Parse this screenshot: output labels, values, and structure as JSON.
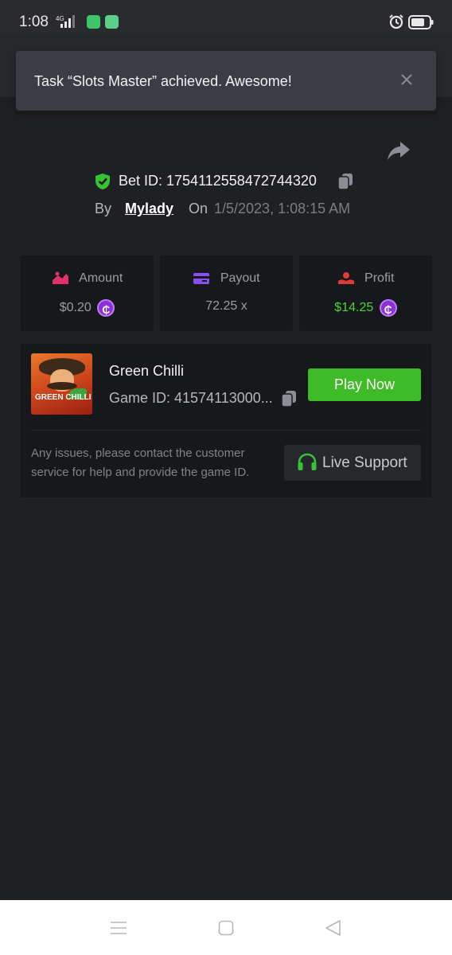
{
  "status_bar": {
    "time": "1:08",
    "network": "4G"
  },
  "toast": {
    "message": "Task “Slots Master” achieved. Awesome!"
  },
  "bet": {
    "id_label": "Bet ID: 1754112558472744320",
    "by_label": "By",
    "username": "Mylady",
    "on_label": "On",
    "date": "1/5/2023, 1:08:15 AM"
  },
  "stats": [
    {
      "label": "Amount",
      "value": "$0.20",
      "icon": "amount-icon",
      "color": "#e0336b"
    },
    {
      "label": "Payout",
      "value": "72.25 x",
      "icon": "payout-icon",
      "color": "#8a4df0"
    },
    {
      "label": "Profit",
      "value": "$14.25",
      "icon": "profit-icon",
      "color": "#e03a3a"
    }
  ],
  "coin_symbol": "₵",
  "game": {
    "title": "Green Chilli",
    "id_label": "Game ID: 41574113000...",
    "thumb_text": "GREEN CHILLI",
    "play_label": "Play Now"
  },
  "support": {
    "message": "Any issues, please contact the customer service for help and provide the game ID.",
    "button_label": "Live Support"
  },
  "colors": {
    "background": "#1f2023",
    "card": "#17181b",
    "accent_green": "#3fbb27",
    "profit_green": "#4bd436",
    "coin_purple": "#8b2fd8"
  }
}
